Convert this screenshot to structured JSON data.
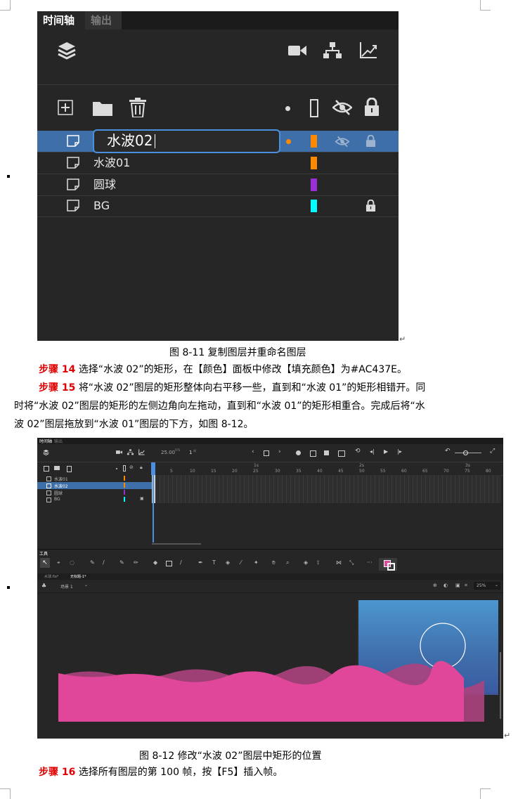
{
  "figure1": {
    "tabs": [
      "时间轴",
      "输出"
    ],
    "rename_value": "水波02",
    "layers": [
      {
        "name": "水波02",
        "color": "#ff8a00",
        "selected": true
      },
      {
        "name": "水波01",
        "color": "#ff8a00",
        "selected": false
      },
      {
        "name": "圆球",
        "color": "#9b2fd6",
        "selected": false
      },
      {
        "name": "BG",
        "color": "#00ffff",
        "selected": false
      }
    ],
    "caption": "图  8-11  复制图层并重命名图层"
  },
  "step14": {
    "label": "步骤 14",
    "text": "选择“水波 02”的矩形，在【颜色】面板中修改【填充颜色】为#AC437E。"
  },
  "step15": {
    "label": "步骤 15",
    "line1": "将“水波 02”图层的矩形整体向右平移一些，直到和“水波 01”的矩形相错开。同",
    "line2": "时将“水波 02”图层的矩形的左侧边角向左拖动，直到和“水波 01”的矩形相重合。完成后将“水",
    "line3": "波 02”图层拖放到“水波 01”图层的下方，如图 8-12。"
  },
  "figure2": {
    "tabs": [
      "时间轴",
      "输出"
    ],
    "fps": "25.00",
    "fps_unit": "FPS",
    "frame": "1",
    "frame_unit": "帧",
    "ruler_sec": [
      "1s",
      "2s",
      "3s"
    ],
    "ruler": [
      "5",
      "10",
      "15",
      "20",
      "25",
      "30",
      "35",
      "40",
      "45",
      "50",
      "55",
      "60",
      "65",
      "70",
      "75",
      "80"
    ],
    "layers": [
      {
        "name": "水波01",
        "color": "#ff8a00"
      },
      {
        "name": "水波02",
        "color": "#ff8a00"
      },
      {
        "name": "圆球",
        "color": "#9b2fd6"
      },
      {
        "name": "BG",
        "color": "#00ffff"
      }
    ],
    "tools_title": "工具",
    "doc_tabs": [
      "水球.fla*",
      "无标题-1*"
    ],
    "scene": "场景 1",
    "zoom": "25%",
    "caption": "图  8-12  修改“水波 02”图层中矩形的位置"
  },
  "step16": {
    "label": "步骤 16",
    "text": "选择所有图层的第 100 帧，按【F5】插入帧。"
  },
  "colors": {
    "panel_bg": "#262626",
    "selection": "#3e6fa8",
    "accent_blue": "#4a8fe0",
    "wave_front": "#e0479a",
    "wave_back": "#ac437e"
  }
}
